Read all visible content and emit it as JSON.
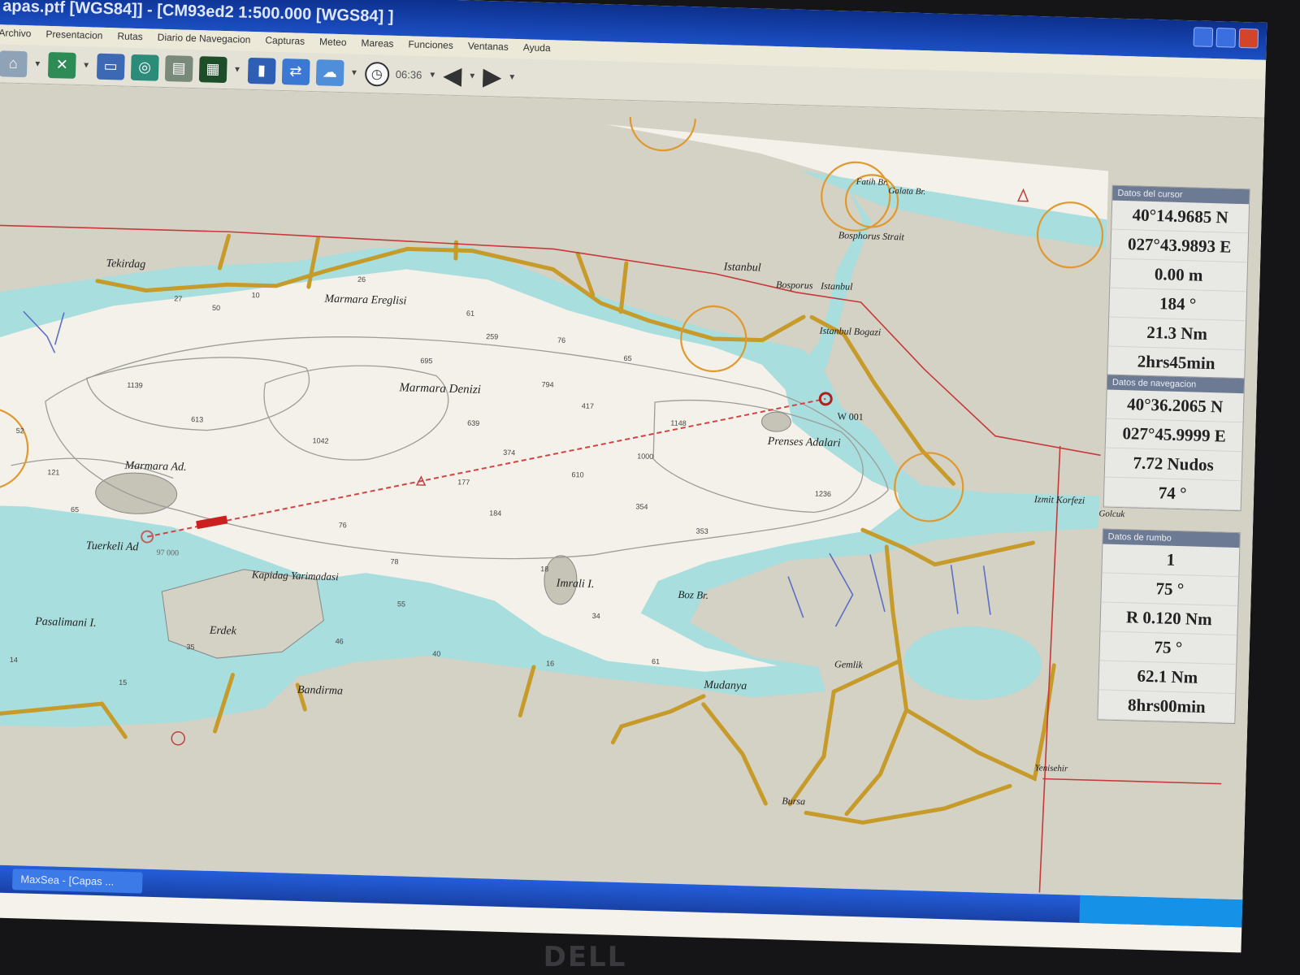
{
  "window": {
    "title": "apas.ptf [WGS84]] - [CM93ed2  1:500.000 [WGS84] ]"
  },
  "menu": [
    "Archivo",
    "Presentacion",
    "Rutas",
    "Diario de Navegacion",
    "Capturas",
    "Meteo",
    "Mareas",
    "Funciones",
    "Ventanas",
    "Ayuda"
  ],
  "toolbar": {
    "time": "06:36"
  },
  "map": {
    "places": {
      "tekirdag": "Tekirdag",
      "marmara_ereglisi": "Marmara Ereglisi",
      "istanbul": "Istanbul",
      "istanbul2": "Istanbul",
      "bosphorus": "Bosphorus Strait",
      "bosporus": "Bosporus",
      "istanbul_bogazi": "Istanbul Bogazi",
      "fatih_br": "Fatih Br.",
      "galata_br": "Galata Br.",
      "marmara_denizi": "Marmara Denizi",
      "prenses_adalari": "Prenses Adalari",
      "wp_label": "W 001",
      "marmara_ad": "Marmara Ad.",
      "tuerkeli_ad": "Tuerkeli Ad",
      "kapidag": "Kapidag Yarimadasi",
      "imrali": "Imrali I.",
      "boz_br": "Boz Br.",
      "pasalimani": "Pasalimani I.",
      "erdek": "Erdek",
      "bandirma": "Bandirma",
      "mudanya": "Mudanya",
      "gemlik": "Gemlik",
      "bursa": "Bursa",
      "izmit": "Izmit Korfezi",
      "golcuk": "Golcuk",
      "yenisehir": "Yenisehir"
    },
    "depths": [
      "26",
      "27",
      "10",
      "50",
      "61",
      "259",
      "76",
      "65",
      "695",
      "794",
      "417",
      "1139",
      "613",
      "1042",
      "639",
      "374",
      "610",
      "1148",
      "1000",
      "1236",
      "354",
      "353",
      "184",
      "177",
      "121",
      "52",
      "65",
      "76",
      "78",
      "55",
      "40",
      "34",
      "61",
      "16",
      "46",
      "15",
      "14",
      "35",
      "18"
    ],
    "ship_label": "97 000"
  },
  "panels": {
    "cursor": {
      "title": "Datos del cursor",
      "lat": "40°14.9685 N",
      "lon": "027°43.9893 E",
      "depth": "0.00 m",
      "bearing": "184 °",
      "distance": "21.3 Nm",
      "time": "2hrs45min"
    },
    "navigation": {
      "title": "Datos de navegacion",
      "lat": "40°36.2065 N",
      "lon": "027°45.9999 E",
      "speed": "7.72 Nudos",
      "course": "74 °"
    },
    "route": {
      "title": "Datos de rumbo",
      "waypoint": "1",
      "bearing": "75 °",
      "xte": "R 0.120 Nm",
      "course": "75 °",
      "distance": "62.1 Nm",
      "time": "8hrs00min"
    }
  },
  "taskbar": {
    "item": "MaxSea - [Capas ..."
  },
  "monitor": {
    "brand": "DELL"
  },
  "colors": {
    "land": "#d4d1c5",
    "shallow": "#a8dede",
    "deep": "#f3f1e9",
    "road": "#c79b2a",
    "route": "#d24444",
    "circle": "#e0992e"
  }
}
